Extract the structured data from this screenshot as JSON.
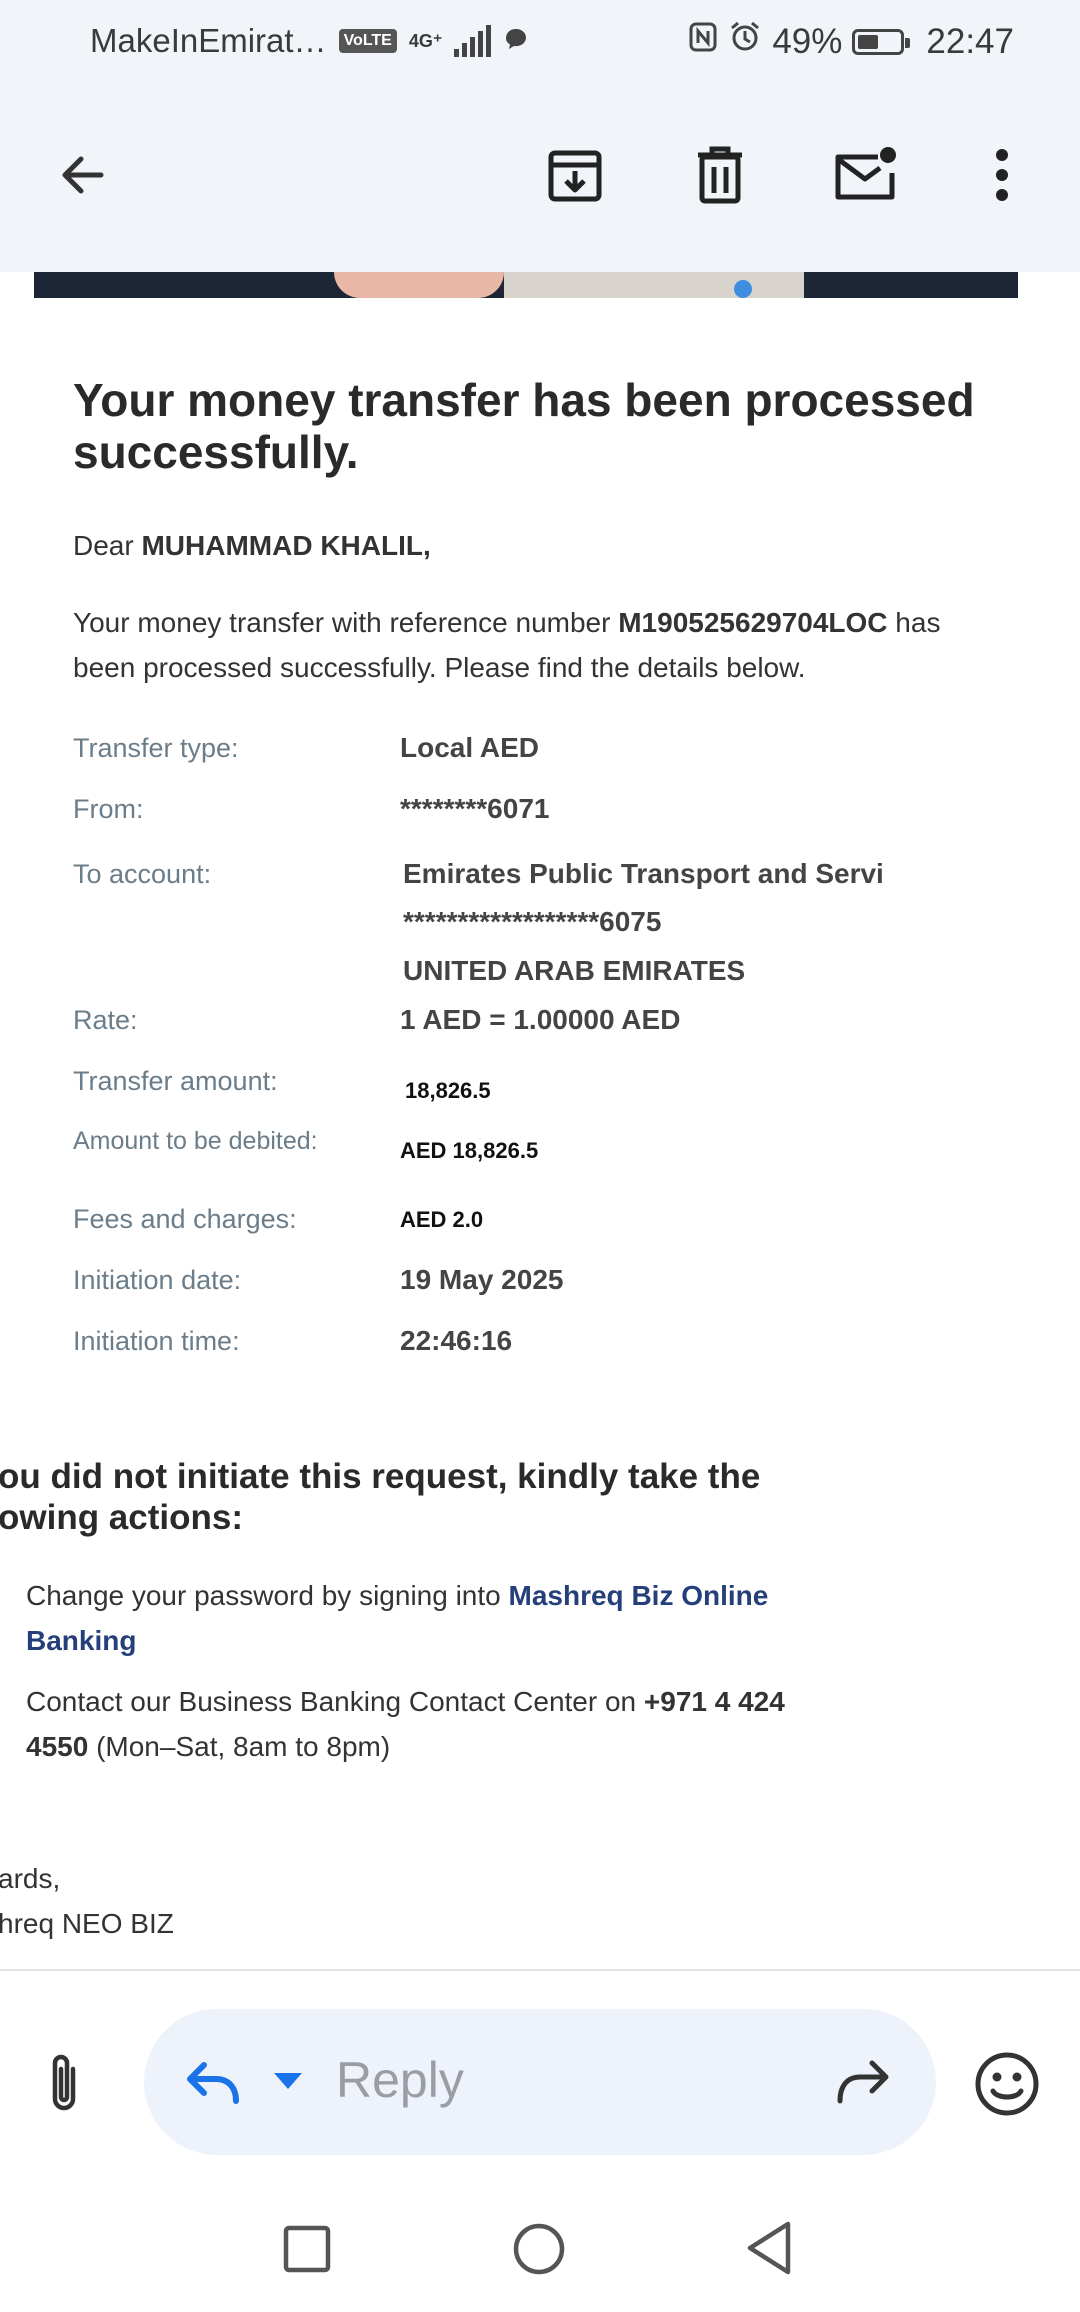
{
  "status_bar": {
    "carrier": "MakeInEmirat…",
    "volte": "VoLTE",
    "network": "4G⁺",
    "battery_percent": "49%",
    "battery_level": 0.49,
    "time": "22:47"
  },
  "toolbar": {
    "back_icon": "arrow-left-icon",
    "archive_icon": "archive-icon",
    "delete_icon": "trash-icon",
    "mark_unread_icon": "mail-unread-icon",
    "more_icon": "more-vertical-icon"
  },
  "email": {
    "title": "Your money transfer has been processed successfully.",
    "greeting_prefix": "Dear ",
    "greeting_name": "MUHAMMAD KHALIL,",
    "intro_prefix": "Your money transfer with reference number ",
    "reference": "M190525629704LOC",
    "intro_suffix": " has been processed successfully. Please find the details below.",
    "details": {
      "transfer_type_label": "Transfer type:",
      "transfer_type_value": "Local AED",
      "from_label": "From:",
      "from_value": "********6071",
      "to_label": "To account:",
      "to_value_line1": "Emirates Public Transport and Servi",
      "to_value_line2": "******************6075",
      "to_value_line3": "UNITED ARAB EMIRATES",
      "rate_label": "Rate:",
      "rate_value": "1 AED = 1.00000 AED",
      "transfer_amount_label": "Transfer amount:",
      "transfer_amount_value": "18,826.5",
      "debited_label": "Amount to be debited:",
      "debited_value": "AED 18,826.5",
      "fees_label": "Fees and charges:",
      "fees_value": "AED 2.0",
      "init_date_label": "Initiation date:",
      "init_date_value": "19 May 2025",
      "init_time_label": "Initiation time:",
      "init_time_value": "22:46:16"
    },
    "warning_title_line1": "ou did not initiate this request, kindly take the",
    "warning_title_line2": "owing actions:",
    "action1_prefix": "Change your password by signing into ",
    "action1_link_line1": "Mashreq Biz Online",
    "action1_link_line2": "Banking",
    "action2_prefix": "Contact our Business Banking Contact Center on ",
    "action2_phone_line1": "+971 4 424",
    "action2_phone_line2": "4550",
    "action2_suffix": " (Mon–Sat, 8am to 8pm)",
    "signoff_line1": "ards,",
    "signoff_line2": "hreq NEO BIZ"
  },
  "bottom_bar": {
    "attach_icon": "paperclip-icon",
    "reply_icon": "reply-icon",
    "reply_dropdown_icon": "caret-down-icon",
    "reply_placeholder": "Reply",
    "forward_icon": "forward-icon",
    "emoji_icon": "emoji-icon"
  },
  "nav_bar": {
    "recents_icon": "square-icon",
    "home_icon": "circle-icon",
    "back_icon": "triangle-back-icon"
  }
}
